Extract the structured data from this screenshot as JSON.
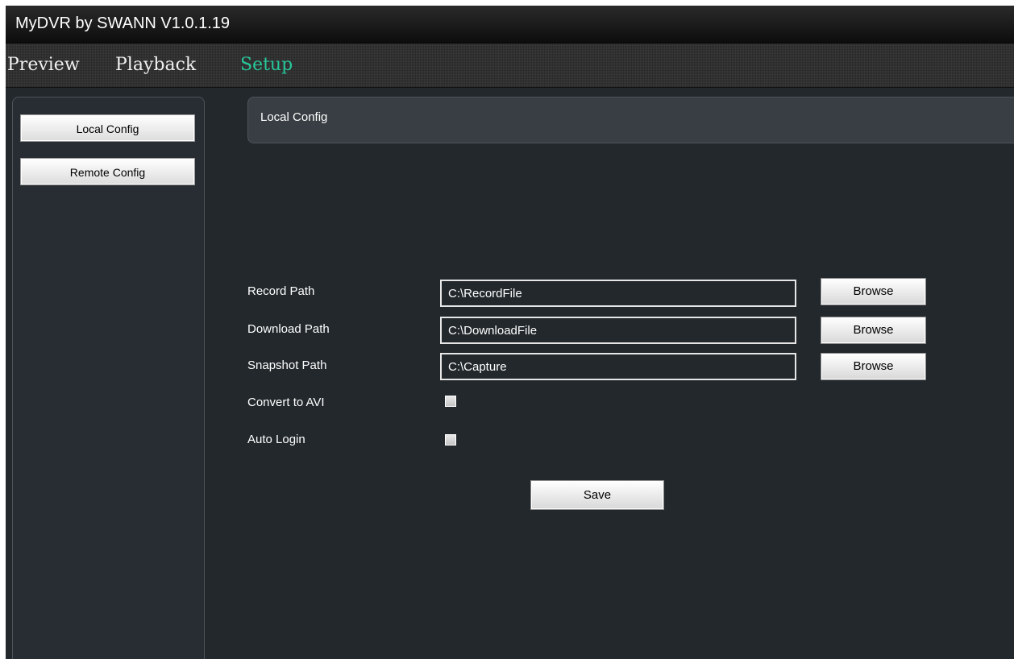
{
  "window": {
    "title": "MyDVR by SWANN  V1.0.1.19"
  },
  "nav": {
    "tabs": [
      {
        "label": "Preview",
        "active": false
      },
      {
        "label": "Playback",
        "active": false
      },
      {
        "label": "Setup",
        "active": true
      }
    ],
    "active_color": "#27c79a"
  },
  "sidebar": {
    "items": [
      {
        "label": "Local Config"
      },
      {
        "label": "Remote Config"
      }
    ]
  },
  "section": {
    "title": "Local Config"
  },
  "form": {
    "record_path": {
      "label": "Record Path",
      "value": "C:\\RecordFile",
      "button": "Browse"
    },
    "download_path": {
      "label": "Download Path",
      "value": "C:\\DownloadFile",
      "button": "Browse"
    },
    "snapshot_path": {
      "label": "Snapshot Path",
      "value": "C:\\Capture",
      "button": "Browse"
    },
    "convert_avi": {
      "label": "Convert to AVI",
      "checked": false
    },
    "auto_login": {
      "label": "Auto Login",
      "checked": false
    },
    "save_label": "Save"
  }
}
